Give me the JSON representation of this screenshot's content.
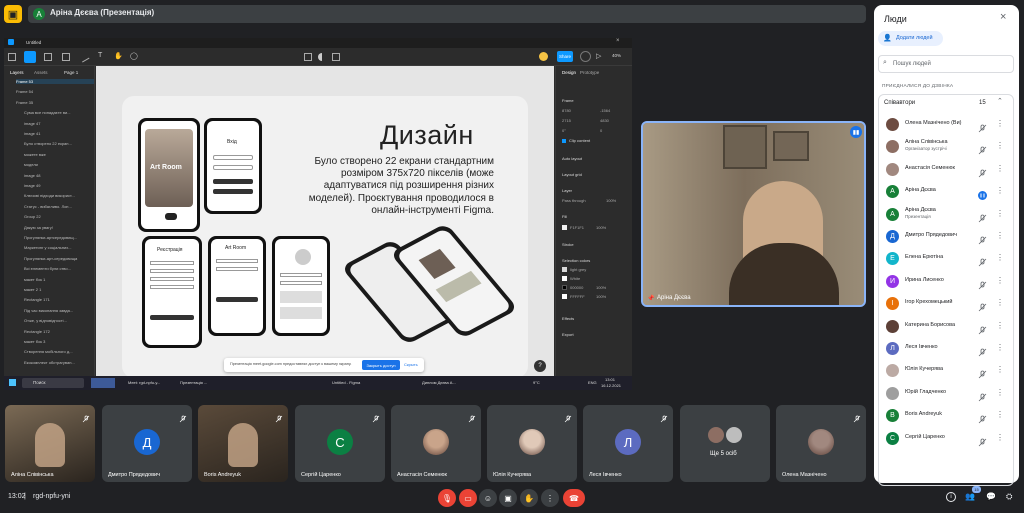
{
  "presenter_bar": {
    "avatar_letter": "А",
    "title": "Аріна Дєєва (Презентація)"
  },
  "figma": {
    "tab_title": "Untitled",
    "share_label": "Share",
    "zoom": "40%",
    "left_tabs": [
      "Layers",
      "Assets",
      "Page 1"
    ],
    "layers": [
      "Frame 53",
      "Frame 54",
      "Frame 35",
      "Сума все попадаєте ви...",
      "image 47",
      "image 41",
      "Було створено 22 екран...",
      "можете вже",
      "модели",
      "image 48",
      "image 49",
      "Ключові підходи використ...",
      "Статус - вибагливо. Лоп...",
      "Group 22",
      "Дякую за увагу!",
      "Прогулянки-артсередовищ...",
      "Маркетинг у соціальних...",
      "Прогулянки-арт-середовища",
      "Всі елементи були ство...",
      "макет бок 1",
      "макет 2 1",
      "Rectangle 171",
      "Під час виконання завда...",
      "Отже, у відповідності...",
      "Rectangle 172",
      "макет бок 3",
      "Створення мобільного д...",
      "Екскомплект обстрагуван..."
    ],
    "right_tabs": [
      "Design",
      "Prototype"
    ],
    "right_sections": [
      "Frame",
      "Clip content",
      "Auto layout",
      "Layout grid",
      "Layer",
      "Pass through",
      "Fill",
      "Stroke",
      "Selection colors",
      "Effects",
      "Export"
    ],
    "frame_values": {
      "x": "8780",
      "y": "-1564",
      "w": "2715",
      "h": "4830",
      "r": "0°",
      "c": "0"
    },
    "layer_opacity": "100%",
    "fill_value": "F1F1F1",
    "fill_opacity": "100%",
    "selection_colors": [
      "light grey",
      "White",
      "000000",
      "FFFFFF"
    ],
    "selection_opacity": "100%"
  },
  "slide": {
    "title": "Дизайн",
    "body": "Було створено 22 екрани стандартним розміром 375х720 пікселів (може адаптуватися під розширення різних моделей). Проєктування проводилося в онлайн-інструменті Figma.",
    "screens": [
      "Art Room",
      "Вхід",
      "Реєстрація",
      "Art Room"
    ]
  },
  "share_notice": {
    "text": "Презентація meet.google.com предоставляє доступ к вашему экрану.",
    "stop_label": "Закрыть доступ",
    "hide_label": "Скрыть"
  },
  "taskbar": {
    "search": "Поиск",
    "apps": [
      "Meet: rgd-npfu-y...",
      "Презентація ...",
      "Untitled - Figma",
      "Диплом Дєєва А..."
    ],
    "weather": "9°C",
    "lang": "ENG",
    "time": "13:01",
    "date": "16.12.2021"
  },
  "speaker": {
    "name": "Аріна Дєєва"
  },
  "people_panel": {
    "title": "Люди",
    "add_button": "Додати людей",
    "search_placeholder": "Пошук людей",
    "section_label": "ПРИЄДНАЛИСЯ ДО ДЗВІНКА",
    "group_label": "Співавтори",
    "group_count": "15",
    "people": [
      {
        "name": "Олена Мазнічено (Ви)",
        "role": "",
        "letter": "",
        "color": "#6d4c41"
      },
      {
        "name": "Аліна Слівінська",
        "role": "Організатор зустрічі",
        "letter": "",
        "color": "#8d6e63"
      },
      {
        "name": "Анастасія Семенюк",
        "role": "",
        "letter": "",
        "color": "#a1887f"
      },
      {
        "name": "Аріна Дєєва",
        "role": "",
        "letter": "А",
        "color": "#188038"
      },
      {
        "name": "Аріна Дєєва",
        "role": "Презентація",
        "letter": "А",
        "color": "#188038"
      },
      {
        "name": "Дмитро Прядедович",
        "role": "",
        "letter": "Д",
        "color": "#1967d2"
      },
      {
        "name": "Елена Ерютіна",
        "role": "",
        "letter": "Е",
        "color": "#12b5cb"
      },
      {
        "name": "Ирина Лисенко",
        "role": "",
        "letter": "И",
        "color": "#9334e6"
      },
      {
        "name": "Ігор Крехомецький",
        "role": "",
        "letter": "І",
        "color": "#e8710a"
      },
      {
        "name": "Катерина Борисова",
        "role": "",
        "letter": "",
        "color": "#5d4037"
      },
      {
        "name": "Леся Івченко",
        "role": "",
        "letter": "Л",
        "color": "#5c6bc0"
      },
      {
        "name": "Юлія Кучерява",
        "role": "",
        "letter": "",
        "color": "#bcaaa4"
      },
      {
        "name": "Юрій Гладченко",
        "role": "",
        "letter": "",
        "color": "#9e9e9e"
      },
      {
        "name": "Boris Andreyuk",
        "role": "",
        "letter": "B",
        "color": "#188038"
      },
      {
        "name": "Сергій Царенко",
        "role": "",
        "letter": "С",
        "color": "#0b8043"
      }
    ]
  },
  "tiles": [
    {
      "name": "Аліна Слівінська",
      "kind": "video",
      "letter": "",
      "color": "#7b6a55"
    },
    {
      "name": "Дмитро Прядедович",
      "kind": "avatar",
      "letter": "Д",
      "color": "#1967d2"
    },
    {
      "name": "Boris Andreyuk",
      "kind": "video",
      "letter": "",
      "color": "#5a4a3a"
    },
    {
      "name": "Сергій Царенко",
      "kind": "avatar",
      "letter": "С",
      "color": "#0b8043"
    },
    {
      "name": "Анастасія Семенюк",
      "kind": "photo",
      "letter": "",
      "color": "#c9a48a"
    },
    {
      "name": "Юлія Кучерява",
      "kind": "photo",
      "letter": "",
      "color": "#e0c9b8"
    },
    {
      "name": "Леся Івченко",
      "kind": "avatar",
      "letter": "Л",
      "color": "#5c6bc0"
    },
    {
      "name": "Ще 5 осіб",
      "kind": "group",
      "letter": "",
      "color": "#8d6e63"
    },
    {
      "name": "Олена Мазнічено",
      "kind": "photo",
      "letter": "",
      "color": "#a1887f"
    }
  ],
  "bottom_bar": {
    "time": "13:02",
    "code": "rgd-npfu-yni",
    "participants_badge": "15"
  },
  "colors": {
    "accent_blue": "#8ab4f8",
    "leave_red": "#ea4335",
    "figma_blue": "#0d99ff"
  }
}
